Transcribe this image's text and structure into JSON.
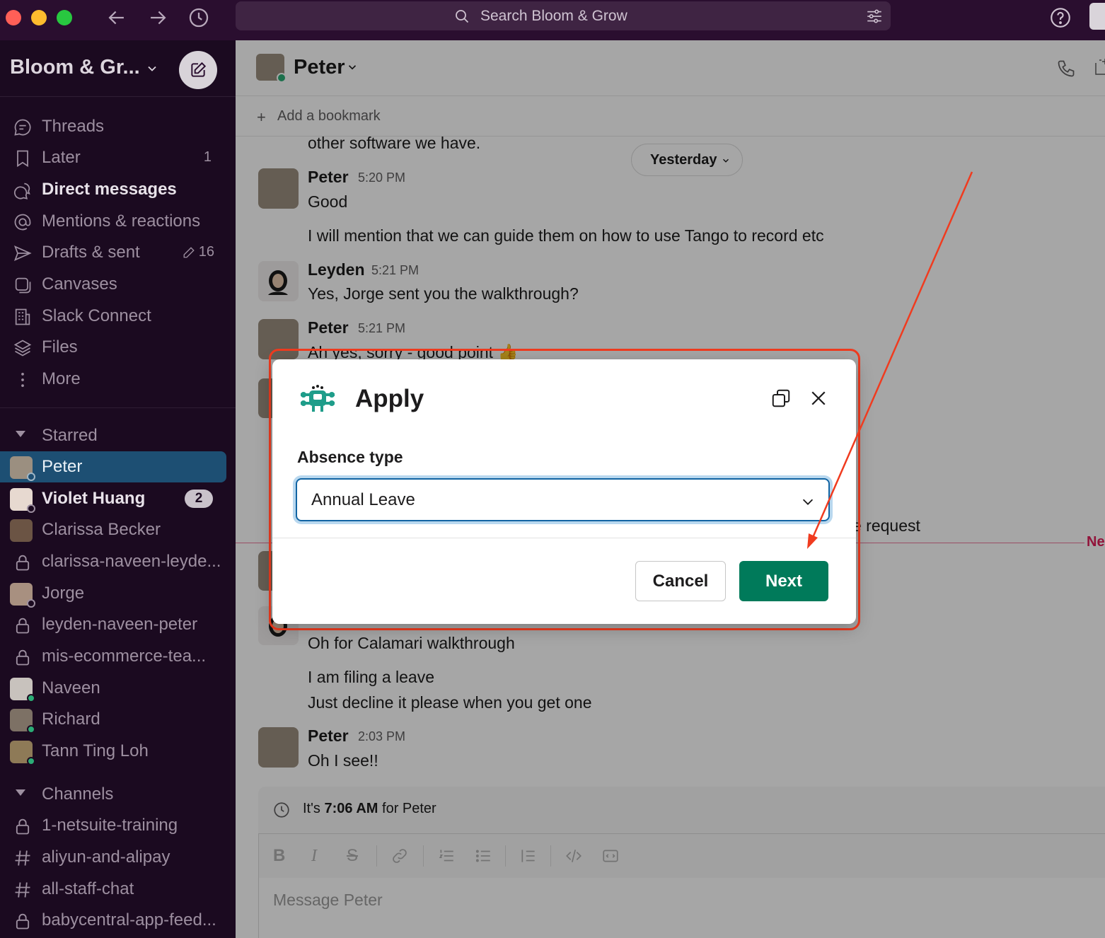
{
  "titlebar": {
    "search_placeholder": "Search Bloom & Grow"
  },
  "sidebar": {
    "workspace_name": "Bloom & Gr...",
    "nav": [
      {
        "label": "Threads",
        "icon": "threads-icon",
        "count": ""
      },
      {
        "label": "Later",
        "icon": "bookmark-icon",
        "count": "1"
      },
      {
        "label": "Direct messages",
        "icon": "dm-icon",
        "count": ""
      },
      {
        "label": "Mentions & reactions",
        "icon": "at-icon",
        "count": ""
      },
      {
        "label": "Drafts & sent",
        "icon": "send-icon",
        "count": "16"
      },
      {
        "label": "Canvases",
        "icon": "canvas-icon",
        "count": ""
      },
      {
        "label": "Slack Connect",
        "icon": "building-icon",
        "count": ""
      },
      {
        "label": "Files",
        "icon": "layers-icon",
        "count": ""
      },
      {
        "label": "More",
        "icon": "more-vertical-icon",
        "count": ""
      }
    ],
    "starred_label": "Starred",
    "starred": [
      {
        "label": "Peter",
        "badge": ""
      },
      {
        "label": "Violet Huang",
        "badge": "2"
      },
      {
        "label": "Clarissa Becker",
        "badge": ""
      },
      {
        "label": "clarissa-naveen-leyde...",
        "badge": ""
      },
      {
        "label": "Jorge",
        "badge": ""
      },
      {
        "label": "leyden-naveen-peter",
        "badge": ""
      },
      {
        "label": "mis-ecommerce-tea...",
        "badge": ""
      },
      {
        "label": "Naveen",
        "badge": ""
      },
      {
        "label": "Richard",
        "badge": ""
      },
      {
        "label": "Tann Ting Loh",
        "badge": ""
      }
    ],
    "channels_label": "Channels",
    "channels": [
      {
        "label": "1-netsuite-training"
      },
      {
        "label": "aliyun-and-alipay"
      },
      {
        "label": "all-staff-chat"
      },
      {
        "label": "babycentral-app-feed..."
      }
    ]
  },
  "channel": {
    "name": "Peter",
    "add_bookmark": "Add a bookmark",
    "date_pill": "Yesterday",
    "new_label": "Ne",
    "messages": [
      {
        "text": "other software we have."
      },
      {
        "author": "Peter",
        "time": "5:20 PM",
        "text": "Good"
      },
      {
        "text": "I will mention that we can guide them on how to use Tango to record etc"
      },
      {
        "author": "Leyden",
        "time": "5:21 PM",
        "text": "Yes, Jorge sent you the walkthrough?"
      },
      {
        "author": "Peter",
        "time": "5:21 PM",
        "text": "Ah yes, sorry - good point 👍"
      },
      {
        "text": "e request"
      },
      {
        "text": "Oh for Calamari walkthrough"
      },
      {
        "text": "I am filing a leave"
      },
      {
        "text": "Just decline it please when you get one"
      },
      {
        "author": "Peter",
        "time": "2:03 PM",
        "text": "Oh I see!!"
      }
    ],
    "local_time_prefix": "It's ",
    "local_time": "7:06 AM",
    "local_time_suffix": " for Peter",
    "composer_placeholder": "Message Peter"
  },
  "modal": {
    "title": "Apply",
    "field_label": "Absence type",
    "selected_value": "Annual Leave",
    "cancel_label": "Cancel",
    "next_label": "Next"
  },
  "colors": {
    "sidebar_bg": "#1b0a20",
    "titlebar_bg": "#2a0e2f",
    "active_item": "#1d4f73",
    "next_button": "#007a5a",
    "annotation": "#f03b1f"
  }
}
